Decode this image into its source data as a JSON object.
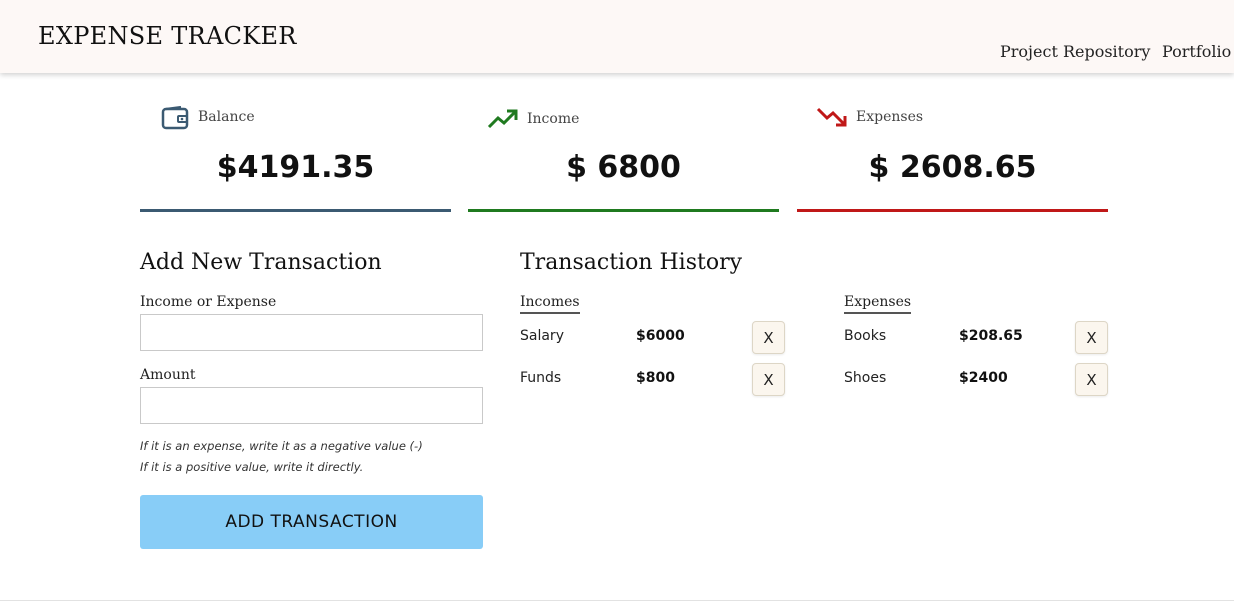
{
  "header": {
    "title": "EXPENSE TRACKER",
    "nav": [
      "Project Repository",
      "Portfolio"
    ]
  },
  "summary": {
    "balance": {
      "label": "Balance",
      "value": "$4191.35",
      "icon": "wallet-icon",
      "color": "#3b5a72"
    },
    "income": {
      "label": "Income",
      "value": "$ 6800",
      "icon": "trending-up-icon",
      "color": "#1f7a1f"
    },
    "expenses": {
      "label": "Expenses",
      "value": "$ 2608.65",
      "icon": "trending-down-icon",
      "color": "#c01818"
    }
  },
  "form": {
    "title": "Add New Transaction",
    "type_label": "Income or Expense",
    "type_value": "",
    "amount_label": "Amount",
    "amount_value": "",
    "hint_line1": "If it is an expense, write it as a negative value (-)",
    "hint_line2": "If it is a positive value, write it directly.",
    "submit_label": "ADD TRANSACTION",
    "submit_color": "#88cdf7"
  },
  "history": {
    "title": "Transaction History",
    "incomes_heading": "Incomes",
    "expenses_heading": "Expenses",
    "delete_label": "X",
    "incomes": [
      {
        "name": "Salary",
        "amount": "$6000"
      },
      {
        "name": "Funds",
        "amount": "$800"
      }
    ],
    "expenses": [
      {
        "name": "Books",
        "amount": "$208.65"
      },
      {
        "name": "Shoes",
        "amount": "$2400"
      }
    ]
  }
}
